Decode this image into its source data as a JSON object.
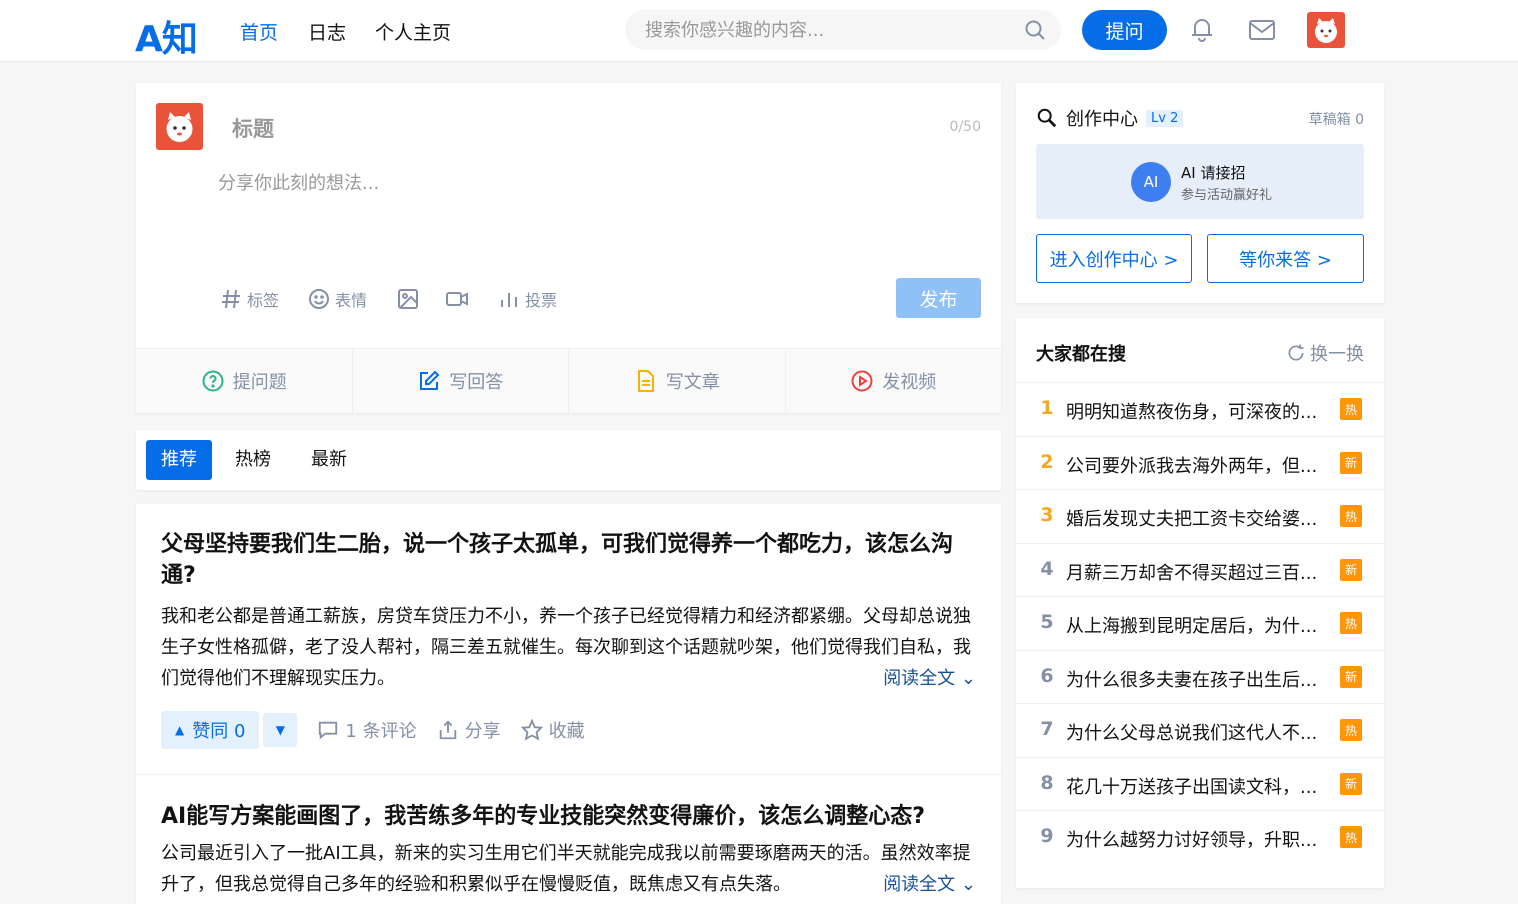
{
  "header": {
    "logo": "A知",
    "nav": [
      "首页",
      "日志",
      "个人主页"
    ],
    "search_placeholder": "搜索你感兴趣的内容...",
    "ask_label": "提问"
  },
  "composer": {
    "title_placeholder": "标题",
    "counter": "0/50",
    "body_placeholder": "分享你此刻的想法...",
    "tools": {
      "tag": "标签",
      "emoji": "表情",
      "poll": "投票"
    },
    "publish_label": "发布",
    "actions": [
      "提问题",
      "写回答",
      "写文章",
      "发视频"
    ]
  },
  "tabs": [
    "推荐",
    "热榜",
    "最新"
  ],
  "feed": [
    {
      "question": "父母坚持要我们生二胎，说一个孩子太孤单，可我们觉得养一个都吃力，该怎么沟通?",
      "excerpt": "我和老公都是普通工薪族，房贷车贷压力不小，养一个孩子已经觉得精力和经济都紧绷。父母却总说独生子女性格孤僻，老了没人帮衬，隔三差五就催生。每次聊到这个话题就吵架，他们觉得我们自私，我们觉得他们不理解现实压力。",
      "read_more": "阅读全文",
      "vote": "赞同 0",
      "comments": "1 条评论",
      "share": "分享",
      "favorite": "收藏"
    },
    {
      "question": "AI能写方案能画图了，我苦练多年的专业技能突然变得廉价，该怎么调整心态?",
      "excerpt": "公司最近引入了一批AI工具，新来的实习生用它们半天就能完成我以前需要琢磨两天的活。虽然效率提升了，但我总觉得自己多年的经验和积累似乎在慢慢贬值，既焦虑又有点失落。",
      "read_more": "阅读全文"
    }
  ],
  "creator": {
    "title": "创作中心",
    "level": "Lv 2",
    "drafts": "草稿箱 0",
    "ai_badge": "AI",
    "ai_title": "AI 请接招",
    "ai_subtitle": "参与活动赢好礼",
    "enter_button": "进入创作中心 >",
    "answer_button": "等你来答 >"
  },
  "hot": {
    "title": "大家都在搜",
    "refresh": "换一换",
    "items": [
      {
        "rank": "1",
        "text": "明明知道熬夜伤身，可深夜的...",
        "badge": "热"
      },
      {
        "rank": "2",
        "text": "公司要外派我去海外两年，但...",
        "badge": "新"
      },
      {
        "rank": "3",
        "text": "婚后发现丈夫把工资卡交给婆...",
        "badge": "热"
      },
      {
        "rank": "4",
        "text": "月薪三万却舍不得买超过三百...",
        "badge": "新"
      },
      {
        "rank": "5",
        "text": "从上海搬到昆明定居后，为什...",
        "badge": "热"
      },
      {
        "rank": "6",
        "text": "为什么很多夫妻在孩子出生后...",
        "badge": "新"
      },
      {
        "rank": "7",
        "text": "为什么父母总说我们这代人不...",
        "badge": "热"
      },
      {
        "rank": "8",
        "text": "花几十万送孩子出国读文科，...",
        "badge": "新"
      },
      {
        "rank": "9",
        "text": "为什么越努力讨好领导，升职...",
        "badge": "热"
      }
    ]
  },
  "colors": {
    "brand": "#056de8",
    "hot_badge": "#ff9607",
    "avatar_bg": "#e9533a"
  }
}
